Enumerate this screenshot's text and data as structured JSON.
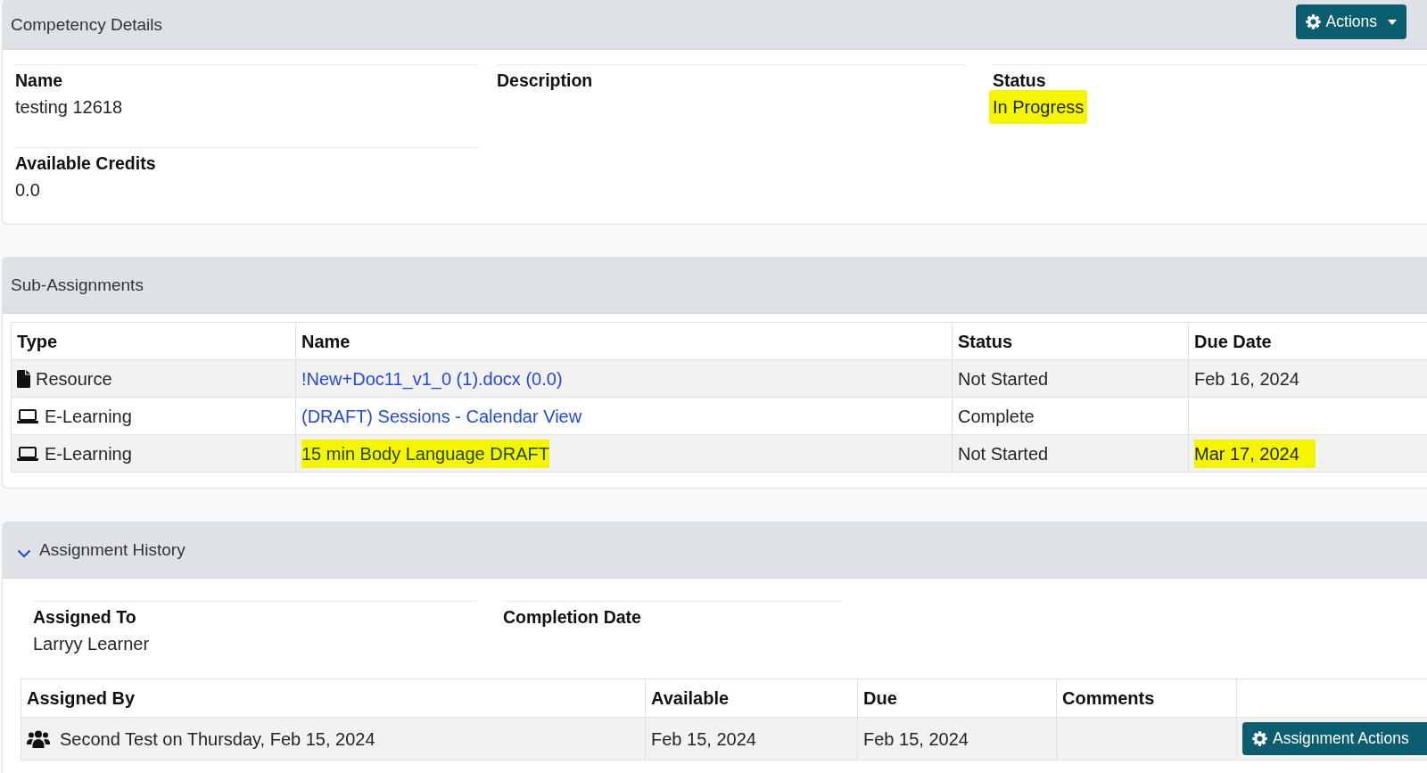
{
  "competency_details": {
    "title": "Competency Details",
    "actions_button": "Actions",
    "columns": [
      {
        "fields": [
          {
            "label": "Name",
            "value": "testing 12618",
            "highlighted": false
          },
          {
            "label": "Available Credits",
            "value": "0.0",
            "highlighted": false
          }
        ]
      },
      {
        "fields": [
          {
            "label": "Description"
          }
        ]
      },
      {
        "fields": [
          {
            "label": "Status",
            "value": "In Progress",
            "highlighted": true
          }
        ]
      }
    ]
  },
  "sub_assignments": {
    "title": "Sub-Assignments",
    "table": {
      "columns": [
        "Type",
        "Name",
        "Status",
        "Due Date"
      ],
      "rows": [
        {
          "kind": "resource",
          "type": "Resource",
          "name": "!New+Doc11_v1_0 (1).docx (0.0)",
          "name_highlighted": false,
          "status": "Not Started",
          "due_date": "Feb 16, 2024",
          "due_date_highlighted": false
        },
        {
          "kind": "e-learning",
          "type": "E-Learning",
          "name": "(DRAFT) Sessions - Calendar View",
          "name_highlighted": false,
          "status": "Complete"
        },
        {
          "kind": "e-learning",
          "type": "E-Learning",
          "name": "15 min Body Language DRAFT",
          "name_highlighted": true,
          "status": "Not Started",
          "due_date": "Mar 17, 2024",
          "due_date_highlighted": true
        }
      ]
    }
  },
  "assignment_history": {
    "title": "Assignment History",
    "expanded": true,
    "fields": [
      {
        "label": "Assigned To",
        "value": "Larryy Learner"
      },
      {
        "label": "Completion Date"
      }
    ],
    "table": {
      "columns": [
        "Assigned By",
        "Available",
        "Due",
        "Comments"
      ],
      "rows": [
        {
          "assigned_by": "Second Test on Thursday, Feb 15, 2024",
          "available": "Feb 15, 2024",
          "due": "Feb 15, 2024",
          "action_button": "Assignment Actions"
        }
      ]
    }
  }
}
